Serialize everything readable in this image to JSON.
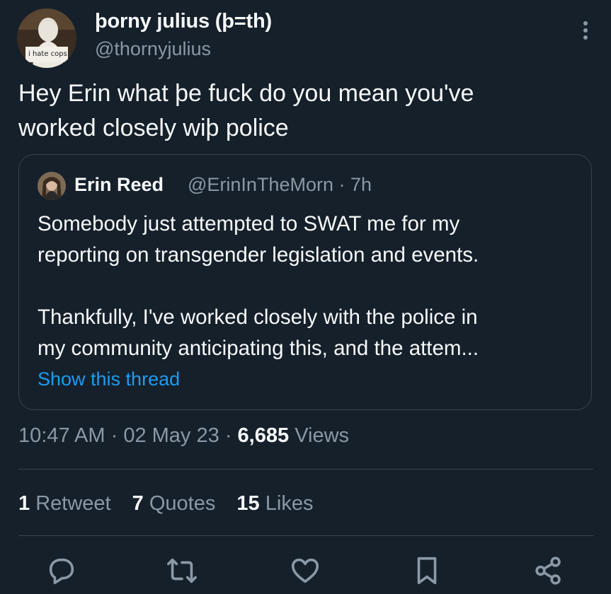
{
  "author": {
    "name": "þorny julius (þ=th)",
    "handle": "@thornyjulius",
    "avatar_caption": "i hate cops"
  },
  "tweet": {
    "lines": [
      "Hey Erin what þe fuck do you mean you've",
      "worked closely wiþ police"
    ]
  },
  "quoted": {
    "name": "Erin Reed",
    "handle_time": "@ErinInTheMorn · 7h",
    "paragraph1": [
      "Somebody just attempted to SWAT me for my",
      "reporting on transgender legislation and events."
    ],
    "paragraph2": [
      "Thankfully, I've worked closely with the police in",
      "my community anticipating this, and the attem..."
    ],
    "show_thread": "Show this thread"
  },
  "meta": {
    "time": "10:47 AM",
    "date": "02 May 23",
    "views_count": "6,685",
    "views_label": "Views",
    "sep": "·"
  },
  "stats": {
    "retweets": {
      "count": "1",
      "label": "Retweet"
    },
    "quotes": {
      "count": "7",
      "label": "Quotes"
    },
    "likes": {
      "count": "15",
      "label": "Likes"
    }
  },
  "actions": [
    "reply-icon",
    "retweet-icon",
    "like-icon",
    "bookmark-icon",
    "share-icon"
  ],
  "colors": {
    "background": "#15202b",
    "text": "#f7f9f9",
    "secondary": "#8b98a5",
    "link": "#1d9bf0",
    "border": "#38444d"
  }
}
